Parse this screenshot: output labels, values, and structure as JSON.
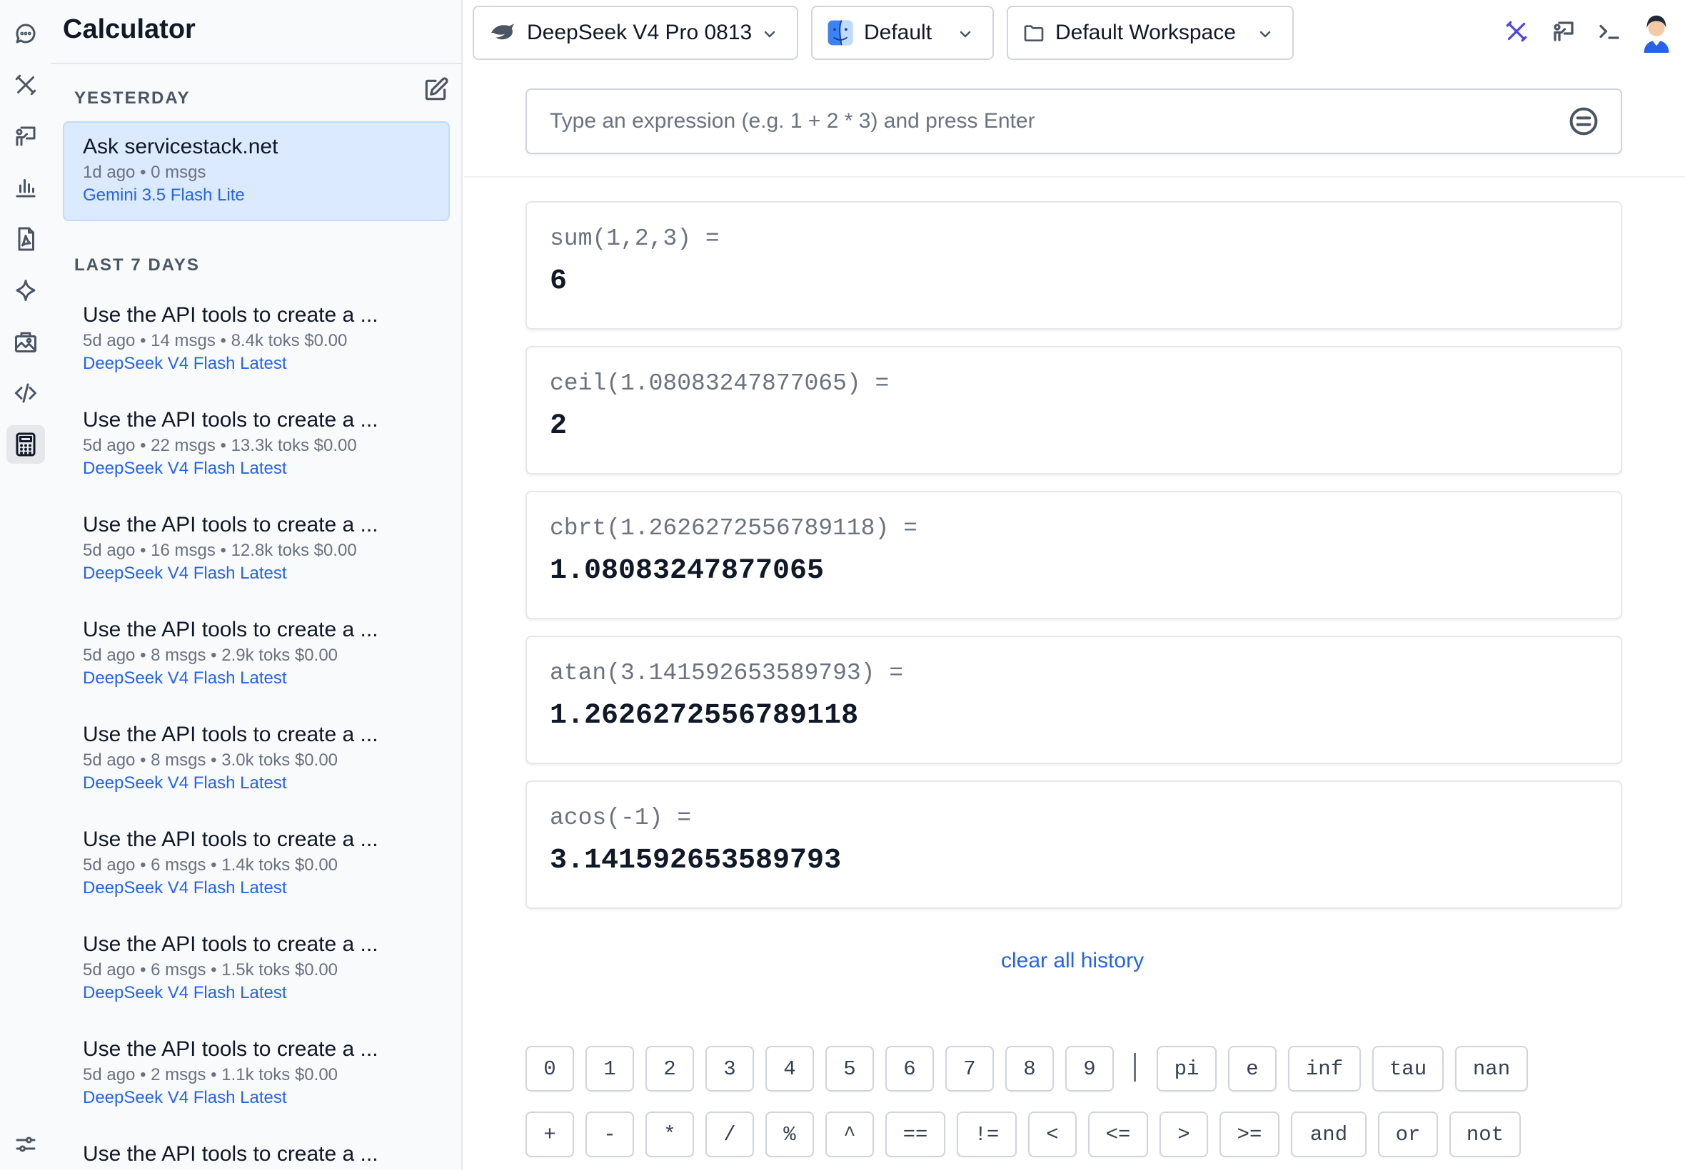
{
  "app": {
    "title": "Calculator"
  },
  "sidebar": {
    "groups": [
      "Yesterday",
      "Last 7 Days"
    ],
    "threads": [
      {
        "title": "Ask servicestack.net",
        "meta": "1d ago • 0 msgs",
        "model": "Gemini 3.5 Flash Lite"
      },
      {
        "title": "Use the API tools to create a ...",
        "meta": "5d ago • 14 msgs • 8.4k toks $0.00",
        "model": "DeepSeek V4 Flash Latest"
      },
      {
        "title": "Use the API tools to create a ...",
        "meta": "5d ago • 22 msgs • 13.3k toks $0.00",
        "model": "DeepSeek V4 Flash Latest"
      },
      {
        "title": "Use the API tools to create a ...",
        "meta": "5d ago • 16 msgs • 12.8k toks $0.00",
        "model": "DeepSeek V4 Flash Latest"
      },
      {
        "title": "Use the API tools to create a ...",
        "meta": "5d ago • 8 msgs • 2.9k toks $0.00",
        "model": "DeepSeek V4 Flash Latest"
      },
      {
        "title": "Use the API tools to create a ...",
        "meta": "5d ago • 8 msgs • 3.0k toks $0.00",
        "model": "DeepSeek V4 Flash Latest"
      },
      {
        "title": "Use the API tools to create a ...",
        "meta": "5d ago • 6 msgs • 1.4k toks $0.00",
        "model": "DeepSeek V4 Flash Latest"
      },
      {
        "title": "Use the API tools to create a ...",
        "meta": "5d ago • 6 msgs • 1.5k toks $0.00",
        "model": "DeepSeek V4 Flash Latest"
      },
      {
        "title": "Use the API tools to create a ...",
        "meta": "5d ago • 2 msgs • 1.1k toks $0.00",
        "model": "DeepSeek V4 Flash Latest"
      },
      {
        "title": "Use the API tools to create a ...",
        "meta": "",
        "model": ""
      }
    ]
  },
  "topbar": {
    "model_select": "DeepSeek V4 Pro 0813",
    "profile_select": "Default",
    "workspace_select": "Default Workspace"
  },
  "calculator": {
    "input_placeholder": "Type an expression (e.g. 1 + 2 * 3) and press Enter",
    "history": [
      {
        "expr": "sum(1,2,3) =",
        "value": "6"
      },
      {
        "expr": "ceil(1.08083247877065) =",
        "value": "2"
      },
      {
        "expr": "cbrt(1.2626272556789118) =",
        "value": "1.08083247877065"
      },
      {
        "expr": "atan(3.141592653589793) =",
        "value": "1.2626272556789118"
      },
      {
        "expr": "acos(-1) =",
        "value": "3.141592653589793"
      }
    ],
    "clear_label": "clear all history",
    "keys_row1": [
      "0",
      "1",
      "2",
      "3",
      "4",
      "5",
      "6",
      "7",
      "8",
      "9",
      "pi",
      "e",
      "inf",
      "tau",
      "nan"
    ],
    "separator": "|",
    "keys_row2": [
      "+",
      "-",
      "*",
      "/",
      "%",
      "^",
      "==",
      "!=",
      "<",
      "<=",
      ">",
      ">=",
      "and",
      "or",
      "not"
    ]
  },
  "colors": {
    "accent": "#2563eb",
    "selected_bg": "#dbeafe",
    "tools_icon": "#4f46e5"
  },
  "icons": {
    "rail": [
      "chat-bubble-icon",
      "tools-icon",
      "presentation-icon",
      "bar-chart-icon",
      "pdf-document-icon",
      "sparkle-icon",
      "image-gallery-icon",
      "code-icon",
      "calculator-icon"
    ],
    "sidebar_bottom": "settings-sliders-icon",
    "topbar": [
      "tools-icon",
      "presentation-icon",
      "terminal-icon",
      "user-avatar-icon"
    ]
  }
}
